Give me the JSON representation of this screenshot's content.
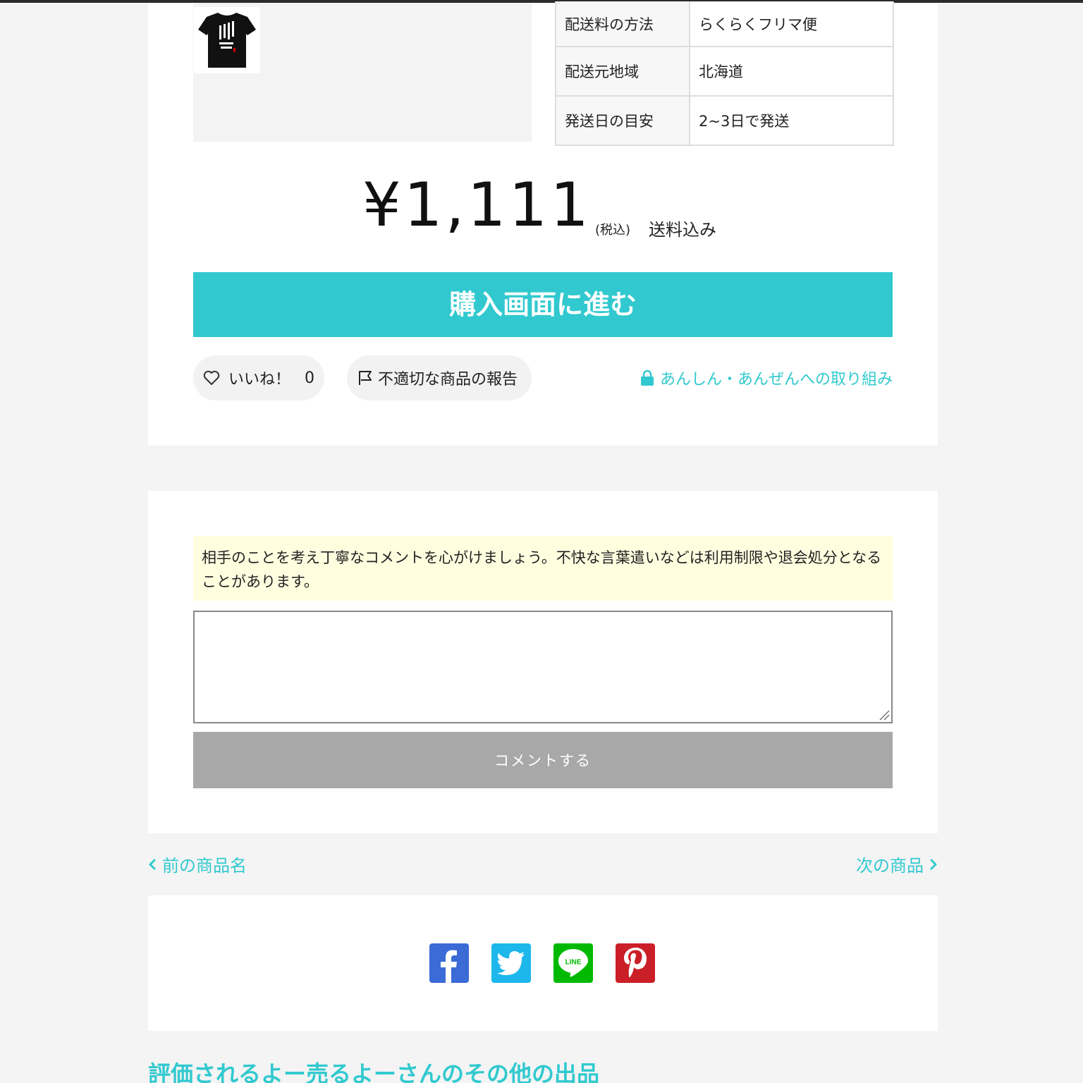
{
  "shipping_table": [
    {
      "label": "配送料の方法",
      "value": "らくらくフリマ便"
    },
    {
      "label": "配送元地域",
      "value": "北海道"
    },
    {
      "label": "発送日の目安",
      "value": "2~3日で発送"
    }
  ],
  "price": {
    "amount": "¥1,111",
    "tax_note": "(税込)",
    "shipping_note": "送料込み"
  },
  "buy_button": {
    "label": "購入画面に進む"
  },
  "actions": {
    "like_label": "いいね！",
    "like_count": "0",
    "report_label": "不適切な商品の報告",
    "safety_link": "あんしん・あんぜんへの取り組み"
  },
  "comments": {
    "notice": "相手のことを考え丁寧なコメントを心がけましょう。不快な言葉遣いなどは利用制限や退会処分となることがあります。",
    "input_value": "",
    "submit_label": "コメントする"
  },
  "navigation": {
    "prev_label": "前の商品名",
    "next_label": "次の商品"
  },
  "share": {
    "icons": [
      "facebook-icon",
      "twitter-icon",
      "line-icon",
      "pinterest-icon"
    ],
    "line_text": "LINE"
  },
  "more_listings": {
    "heading": "評価されるよー売るよーさんのその他の出品"
  },
  "colors": {
    "accent": "#31c9cf",
    "facebook": "#3b6bd6",
    "twitter": "#1cb7eb",
    "line": "#00b900",
    "pinterest": "#cb1f27",
    "notice_bg": "#ffffe0",
    "disabled_button": "#a8a8a8"
  }
}
